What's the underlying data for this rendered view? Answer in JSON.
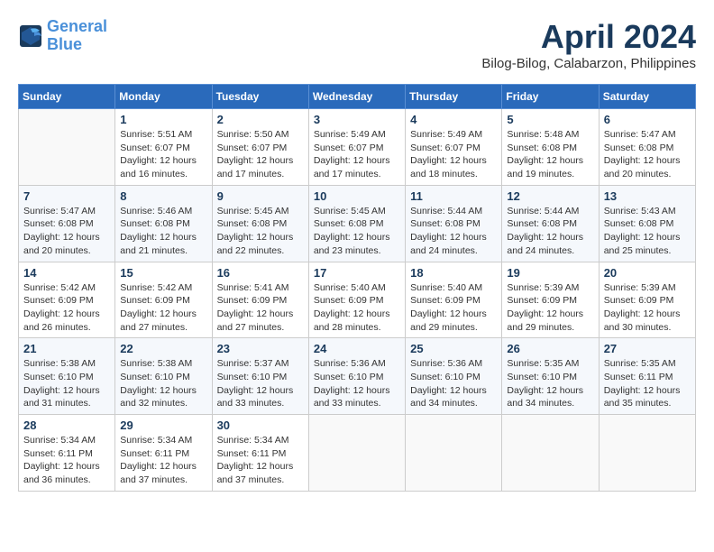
{
  "header": {
    "logo_line1": "General",
    "logo_line2": "Blue",
    "month_title": "April 2024",
    "location": "Bilog-Bilog, Calabarzon, Philippines"
  },
  "weekdays": [
    "Sunday",
    "Monday",
    "Tuesday",
    "Wednesday",
    "Thursday",
    "Friday",
    "Saturday"
  ],
  "weeks": [
    [
      {
        "day": "",
        "info": ""
      },
      {
        "day": "1",
        "info": "Sunrise: 5:51 AM\nSunset: 6:07 PM\nDaylight: 12 hours\nand 16 minutes."
      },
      {
        "day": "2",
        "info": "Sunrise: 5:50 AM\nSunset: 6:07 PM\nDaylight: 12 hours\nand 17 minutes."
      },
      {
        "day": "3",
        "info": "Sunrise: 5:49 AM\nSunset: 6:07 PM\nDaylight: 12 hours\nand 17 minutes."
      },
      {
        "day": "4",
        "info": "Sunrise: 5:49 AM\nSunset: 6:07 PM\nDaylight: 12 hours\nand 18 minutes."
      },
      {
        "day": "5",
        "info": "Sunrise: 5:48 AM\nSunset: 6:08 PM\nDaylight: 12 hours\nand 19 minutes."
      },
      {
        "day": "6",
        "info": "Sunrise: 5:47 AM\nSunset: 6:08 PM\nDaylight: 12 hours\nand 20 minutes."
      }
    ],
    [
      {
        "day": "7",
        "info": "Sunrise: 5:47 AM\nSunset: 6:08 PM\nDaylight: 12 hours\nand 20 minutes."
      },
      {
        "day": "8",
        "info": "Sunrise: 5:46 AM\nSunset: 6:08 PM\nDaylight: 12 hours\nand 21 minutes."
      },
      {
        "day": "9",
        "info": "Sunrise: 5:45 AM\nSunset: 6:08 PM\nDaylight: 12 hours\nand 22 minutes."
      },
      {
        "day": "10",
        "info": "Sunrise: 5:45 AM\nSunset: 6:08 PM\nDaylight: 12 hours\nand 23 minutes."
      },
      {
        "day": "11",
        "info": "Sunrise: 5:44 AM\nSunset: 6:08 PM\nDaylight: 12 hours\nand 24 minutes."
      },
      {
        "day": "12",
        "info": "Sunrise: 5:44 AM\nSunset: 6:08 PM\nDaylight: 12 hours\nand 24 minutes."
      },
      {
        "day": "13",
        "info": "Sunrise: 5:43 AM\nSunset: 6:08 PM\nDaylight: 12 hours\nand 25 minutes."
      }
    ],
    [
      {
        "day": "14",
        "info": "Sunrise: 5:42 AM\nSunset: 6:09 PM\nDaylight: 12 hours\nand 26 minutes."
      },
      {
        "day": "15",
        "info": "Sunrise: 5:42 AM\nSunset: 6:09 PM\nDaylight: 12 hours\nand 27 minutes."
      },
      {
        "day": "16",
        "info": "Sunrise: 5:41 AM\nSunset: 6:09 PM\nDaylight: 12 hours\nand 27 minutes."
      },
      {
        "day": "17",
        "info": "Sunrise: 5:40 AM\nSunset: 6:09 PM\nDaylight: 12 hours\nand 28 minutes."
      },
      {
        "day": "18",
        "info": "Sunrise: 5:40 AM\nSunset: 6:09 PM\nDaylight: 12 hours\nand 29 minutes."
      },
      {
        "day": "19",
        "info": "Sunrise: 5:39 AM\nSunset: 6:09 PM\nDaylight: 12 hours\nand 29 minutes."
      },
      {
        "day": "20",
        "info": "Sunrise: 5:39 AM\nSunset: 6:09 PM\nDaylight: 12 hours\nand 30 minutes."
      }
    ],
    [
      {
        "day": "21",
        "info": "Sunrise: 5:38 AM\nSunset: 6:10 PM\nDaylight: 12 hours\nand 31 minutes."
      },
      {
        "day": "22",
        "info": "Sunrise: 5:38 AM\nSunset: 6:10 PM\nDaylight: 12 hours\nand 32 minutes."
      },
      {
        "day": "23",
        "info": "Sunrise: 5:37 AM\nSunset: 6:10 PM\nDaylight: 12 hours\nand 33 minutes."
      },
      {
        "day": "24",
        "info": "Sunrise: 5:36 AM\nSunset: 6:10 PM\nDaylight: 12 hours\nand 33 minutes."
      },
      {
        "day": "25",
        "info": "Sunrise: 5:36 AM\nSunset: 6:10 PM\nDaylight: 12 hours\nand 34 minutes."
      },
      {
        "day": "26",
        "info": "Sunrise: 5:35 AM\nSunset: 6:10 PM\nDaylight: 12 hours\nand 34 minutes."
      },
      {
        "day": "27",
        "info": "Sunrise: 5:35 AM\nSunset: 6:11 PM\nDaylight: 12 hours\nand 35 minutes."
      }
    ],
    [
      {
        "day": "28",
        "info": "Sunrise: 5:34 AM\nSunset: 6:11 PM\nDaylight: 12 hours\nand 36 minutes."
      },
      {
        "day": "29",
        "info": "Sunrise: 5:34 AM\nSunset: 6:11 PM\nDaylight: 12 hours\nand 37 minutes."
      },
      {
        "day": "30",
        "info": "Sunrise: 5:34 AM\nSunset: 6:11 PM\nDaylight: 12 hours\nand 37 minutes."
      },
      {
        "day": "",
        "info": ""
      },
      {
        "day": "",
        "info": ""
      },
      {
        "day": "",
        "info": ""
      },
      {
        "day": "",
        "info": ""
      }
    ]
  ]
}
